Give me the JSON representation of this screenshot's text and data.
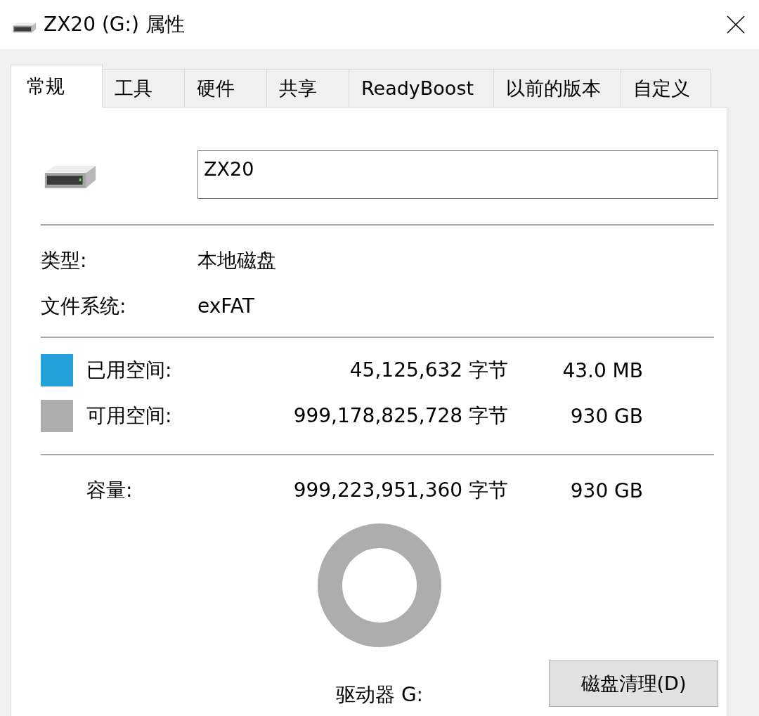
{
  "window": {
    "title": "ZX20 (G:) 属性"
  },
  "tabs": [
    {
      "label": "常规",
      "selected": true
    },
    {
      "label": "工具",
      "selected": false
    },
    {
      "label": "硬件",
      "selected": false
    },
    {
      "label": "共享",
      "selected": false
    },
    {
      "label": "ReadyBoost",
      "selected": false
    },
    {
      "label": "以前的版本",
      "selected": false
    },
    {
      "label": "自定义",
      "selected": false
    }
  ],
  "name_field": {
    "value": "ZX20"
  },
  "properties": [
    {
      "label": "类型:",
      "value": "本地磁盘"
    },
    {
      "label": "文件系统:",
      "value": "exFAT"
    }
  ],
  "usage": [
    {
      "label": "已用空间:",
      "bytes": "45,125,632 字节",
      "size": "43.0 MB",
      "color": "#26a0da"
    },
    {
      "label": "可用空间:",
      "bytes": "999,178,825,728 字节",
      "size": "930 GB",
      "color": "#adadad"
    }
  ],
  "capacity": {
    "label": "容量:",
    "bytes": "999,223,951,360 字节",
    "size": "930 GB"
  },
  "drive_label": "驱动器 G:",
  "buttons": [
    {
      "label": "磁盘清理(D)"
    }
  ]
}
